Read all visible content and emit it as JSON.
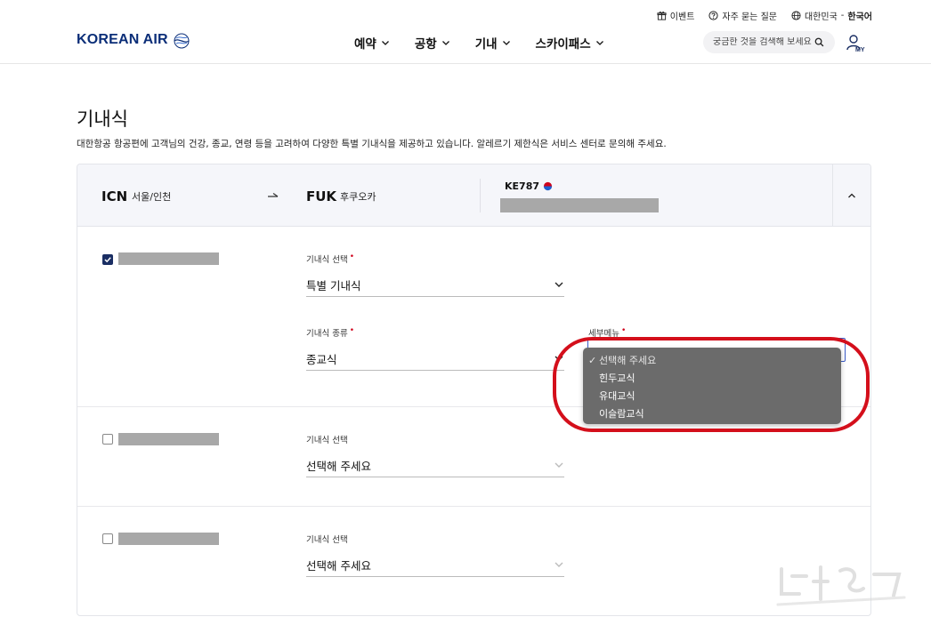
{
  "header": {
    "logo_text": "KOREAN AIR",
    "util": {
      "event": "이벤트",
      "faq": "자주 묻는 질문",
      "region": "대한민국",
      "lang_sep": " - ",
      "lang": "한국어"
    },
    "nav": [
      "예약",
      "공항",
      "기내",
      "스카이패스"
    ],
    "search_placeholder": "궁금한 것을 검색해 보세요",
    "my_label": "MY"
  },
  "page": {
    "title": "기내식",
    "description": "대한항공 항공편에 고객님의 건강, 종교, 연령 등을 고려하여 다양한 특별 기내식을 제공하고 있습니다. 알레르기 제한식은 서비스 센터로 문의해 주세요."
  },
  "flight": {
    "origin_code": "ICN",
    "origin_city": "서울/인천",
    "dest_code": "FUK",
    "dest_city": "후쿠오카",
    "number": "KE787"
  },
  "passengers": [
    {
      "checked": true,
      "meal_select_label": "기내식 선택",
      "meal_select_value": "특별 기내식",
      "meal_type_label": "기내식 종류",
      "meal_type_value": "종교식",
      "sub_menu_label": "세부메뉴",
      "dropdown_options": [
        "선택해 주세요",
        "힌두교식",
        "유대교식",
        "이슬람교식"
      ],
      "selected_option": "선택해 주세요"
    },
    {
      "checked": false,
      "meal_select_label": "기내식 선택",
      "meal_select_value": "선택해 주세요"
    },
    {
      "checked": false,
      "meal_select_label": "기내식 선택",
      "meal_select_value": "선택해 주세요"
    }
  ],
  "colors": {
    "brand": "#0b2e78",
    "checkbox": "#1a2e63",
    "required": "#d0021b",
    "highlight": "#d40f1b",
    "dropdown_bg": "#6b6b6b"
  }
}
